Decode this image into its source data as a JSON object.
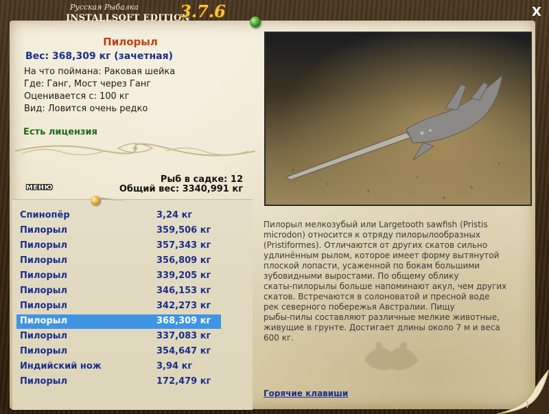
{
  "window": {
    "title_small": "Русская Рыбалка",
    "title_edition": "INSTALLSOFT EDITION",
    "version": "3.7.6",
    "close_label": "X"
  },
  "fish": {
    "name": "Пилорыл",
    "weight_line": "Вес: 368,309 кг (зачетная)",
    "caught_on": "На что поймана: Раковая шейка",
    "location": "Где: Ганг, Мост через Ганг",
    "rated_from": "Оценивается с: 100 кг",
    "species_note": "Вид: Ловится очень редко",
    "license": "Есть лицензия"
  },
  "stats": {
    "fish_in_cage": "Рыб в садке: 12",
    "total_weight": "Общий вес: 3340,991 кг"
  },
  "menu": {
    "label": "МЕНЮ"
  },
  "catch_list": [
    {
      "name": "Спинопёр",
      "weight": "3,24 кг",
      "selected": false
    },
    {
      "name": "Пилорыл",
      "weight": "359,506 кг",
      "selected": false
    },
    {
      "name": "Пилорыл",
      "weight": "357,343 кг",
      "selected": false
    },
    {
      "name": "Пилорыл",
      "weight": "356,809 кг",
      "selected": false
    },
    {
      "name": "Пилорыл",
      "weight": "339,205 кг",
      "selected": false
    },
    {
      "name": "Пилорыл",
      "weight": "346,153 кг",
      "selected": false
    },
    {
      "name": "Пилорыл",
      "weight": "342,273 кг",
      "selected": false
    },
    {
      "name": "Пилорыл",
      "weight": "368,309 кг",
      "selected": true
    },
    {
      "name": "Пилорыл",
      "weight": "337,083 кг",
      "selected": false
    },
    {
      "name": "Пилорыл",
      "weight": "354,647 кг",
      "selected": false
    },
    {
      "name": "Индийский нож",
      "weight": "3,94 кг",
      "selected": false
    },
    {
      "name": "Пилорыл",
      "weight": "172,479 кг",
      "selected": false
    }
  ],
  "description": {
    "lines": [
      "Пилорыл мелкозубый или Largetooth sawfish (Pristis",
      "microdon) относится к отряду пилорылообразных",
      "(Pristiformes). Отличаются от других скатов сильно",
      "удлинённым рылом, которое имеет форму вытянутой",
      "плоской лопасти, усаженной по бокам большими",
      "зубовидными выростами. По общему облику",
      "скаты-пилорылы больше напоминают акул, чем других",
      "скатов. Встречаются в солоноватой и пресной воде",
      "рек северного побережья Австралии. Пищу",
      "рыбы-пилы составляют различные мелкие животные,",
      "живущие в грунте. Достигает длины около 7 м и веса",
      "600 кг."
    ]
  },
  "footer": {
    "hotkeys_label": "Горячие клавиши"
  },
  "colors": {
    "fish_name": "#c0400b",
    "weight_blue": "#1b2e8c",
    "license_green": "#1f6b16",
    "selection": "#3f95e3",
    "version_gold": "#f7c43a"
  }
}
